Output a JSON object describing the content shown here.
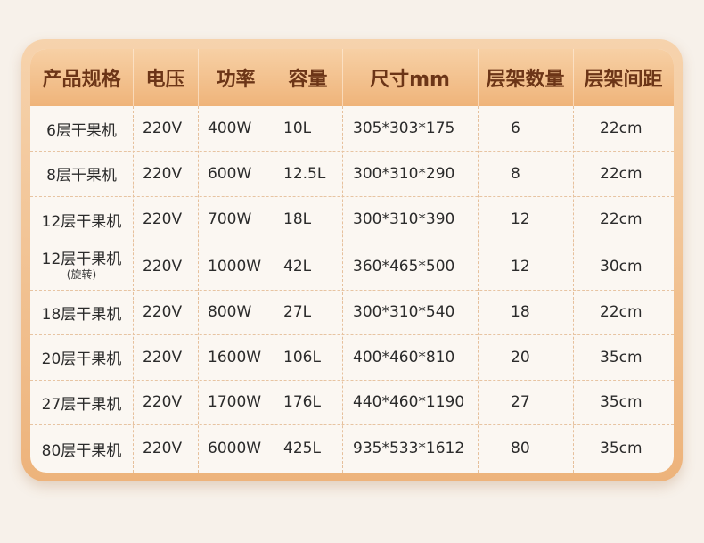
{
  "table": {
    "headers": [
      "产品规格",
      "电压",
      "功率",
      "容量",
      "尺寸mm",
      "层架数量",
      "层架间距"
    ],
    "rows": [
      {
        "product": "6层干果机",
        "product_sub": "",
        "voltage": "220V",
        "power": "400W",
        "capacity": "10L",
        "size": "305*303*175",
        "racks": "6",
        "spacing": "22cm"
      },
      {
        "product": "8层干果机",
        "product_sub": "",
        "voltage": "220V",
        "power": "600W",
        "capacity": "12.5L",
        "size": "300*310*290",
        "racks": "8",
        "spacing": "22cm"
      },
      {
        "product": "12层干果机",
        "product_sub": "",
        "voltage": "220V",
        "power": "700W",
        "capacity": "18L",
        "size": "300*310*390",
        "racks": "12",
        "spacing": "22cm"
      },
      {
        "product": "12层干果机",
        "product_sub": "(旋转)",
        "voltage": "220V",
        "power": "1000W",
        "capacity": "42L",
        "size": "360*465*500",
        "racks": "12",
        "spacing": "30cm"
      },
      {
        "product": "18层干果机",
        "product_sub": "",
        "voltage": "220V",
        "power": "800W",
        "capacity": "27L",
        "size": "300*310*540",
        "racks": "18",
        "spacing": "22cm"
      },
      {
        "product": "20层干果机",
        "product_sub": "",
        "voltage": "220V",
        "power": "1600W",
        "capacity": "106L",
        "size": "400*460*810",
        "racks": "20",
        "spacing": "35cm"
      },
      {
        "product": "27层干果机",
        "product_sub": "",
        "voltage": "220V",
        "power": "1700W",
        "capacity": "176L",
        "size": "440*460*1190",
        "racks": "27",
        "spacing": "35cm"
      },
      {
        "product": "80层干果机",
        "product_sub": "",
        "voltage": "220V",
        "power": "6000W",
        "capacity": "425L",
        "size": "935*533*1612",
        "racks": "80",
        "spacing": "35cm"
      }
    ]
  },
  "colors": {
    "header_bg": "#efb47a",
    "header_text": "#6c3517",
    "frame": "#edb37b",
    "body_bg": "#fbf7f2",
    "divider": "#e6c09c"
  }
}
